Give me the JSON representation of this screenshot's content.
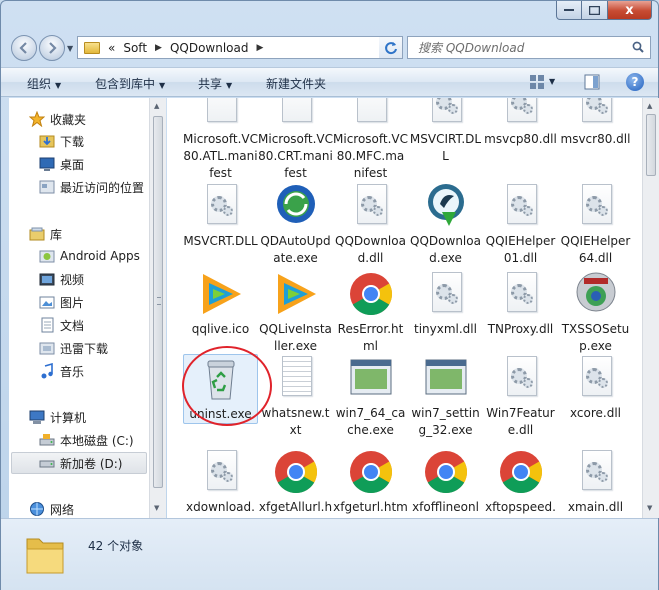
{
  "window": {
    "caption": {
      "close_glyph": "x"
    }
  },
  "address": {
    "overflow": "«",
    "crumbs": [
      "Soft",
      "QQDownload"
    ]
  },
  "search": {
    "placeholder": "搜索 QQDownload"
  },
  "toolbar": {
    "organize": "组织",
    "include_library": "包含到库中",
    "share": "共享",
    "new_folder": "新建文件夹",
    "help": "?"
  },
  "sidebar": {
    "favorites": "收藏夹",
    "downloads": "下载",
    "desktop": "桌面",
    "recent": "最近访问的位置",
    "libraries": "库",
    "android_apps": "Android Apps",
    "videos": "视频",
    "pictures": "图片",
    "documents": "文档",
    "thunder": "迅雷下载",
    "music": "音乐",
    "computer": "计算机",
    "local_disk": "本地磁盘 (C:)",
    "new_volume": "新加卷 (D:)",
    "network": "网络"
  },
  "files": {
    "f1": "Microsoft.VC80.ATL.manifest",
    "f2": "Microsoft.VC80.CRT.manifest",
    "f3": "Microsoft.VC80.MFC.manifest",
    "f4": "MSVCIRT.DLL",
    "f5": "msvcp80.dll",
    "f6": "msvcr80.dll",
    "f7": "MSVCRT.DLL",
    "f8": "QDAutoUpdate.exe",
    "f9": "QQDownload.dll",
    "f10": "QQDownload.exe",
    "f11": "QQIEHelper01.dll",
    "f12": "QQIEHelper64.dll",
    "f13": "qqlive.ico",
    "f14": "QQLiveInstaller.exe",
    "f15": "ResError.html",
    "f16": "tinyxml.dll",
    "f17": "TNProxy.dll",
    "f18": "TXSSOSetup.exe",
    "f19": "uninst.exe",
    "f20": "whatsnew.txt",
    "f21": "win7_64_cache.exe",
    "f22": "win7_setting_32.exe",
    "f23": "Win7Feature.dll",
    "f24": "xcore.dll",
    "f25": "xdownload.dll",
    "f26": "xfgetAllurl.htm",
    "f27": "xfgeturl.htm",
    "f28": "xfofflineonly.htm",
    "f29": "xftopspeed.htm",
    "f30": "xmain.dll"
  },
  "status": {
    "count": "42 个对象"
  },
  "colors": {
    "highlight_circle": "#e0232b",
    "selection": "#cfe4f8"
  }
}
